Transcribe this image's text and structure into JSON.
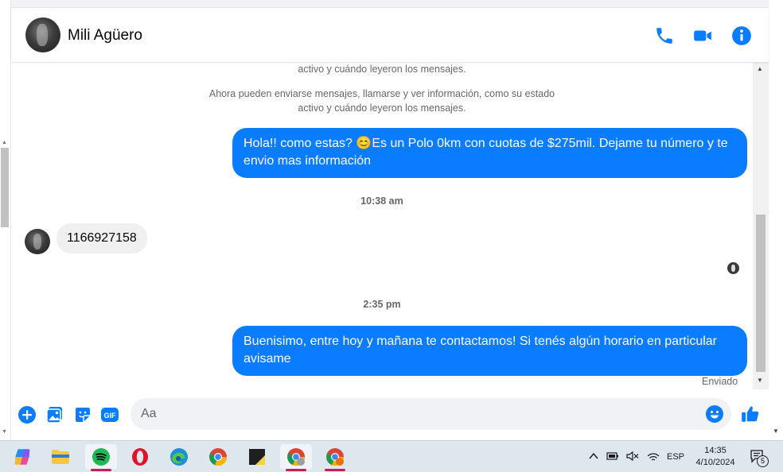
{
  "header": {
    "contact_name": "Mili Agüero",
    "call_icon": "phone-icon",
    "video_icon": "video-camera-icon",
    "info_icon": "info-icon"
  },
  "colors": {
    "accent": "#0a7cff",
    "incoming_bubble": "#f0f0f0",
    "muted_text": "#65676b"
  },
  "chat": {
    "system_line_partial": "activo y cuándo leyeron los mensajes.",
    "system_message_line1": "Ahora pueden enviarse mensajes, llamarse y ver información, como su estado",
    "system_message_line2": "activo y cuándo leyeron los mensajes.",
    "messages": [
      {
        "direction": "out",
        "text": "Hola!! como estas? 😊Es un Polo 0km con cuotas de $275mil. Dejame tu número y te envio mas información"
      },
      {
        "direction": "time",
        "text": "10:38 am"
      },
      {
        "direction": "in",
        "text": "1166927158"
      },
      {
        "direction": "time",
        "text": "2:35 pm"
      },
      {
        "direction": "out",
        "text": "Buenisimo, entre hoy y mañana te contactamos! Si tenés algún horario en particular avisame"
      }
    ],
    "status": "Enviado"
  },
  "composer": {
    "placeholder": "Aa",
    "icons": [
      "plus-circle-icon",
      "photo-icon",
      "sticker-icon",
      "gif-icon",
      "emoji-icon",
      "thumbs-up-icon"
    ],
    "gif_label": "GIF"
  },
  "taskbar": {
    "apps": [
      "copilot-icon",
      "file-explorer-icon",
      "spotify-icon",
      "opera-icon",
      "edge-icon",
      "chrome-icon",
      "sticky-notes-icon",
      "chrome-profile-icon",
      "chrome-profile-2-icon"
    ],
    "language": "ESP",
    "time": "14:35",
    "date": "4/10/2024",
    "notification_count": "5"
  }
}
